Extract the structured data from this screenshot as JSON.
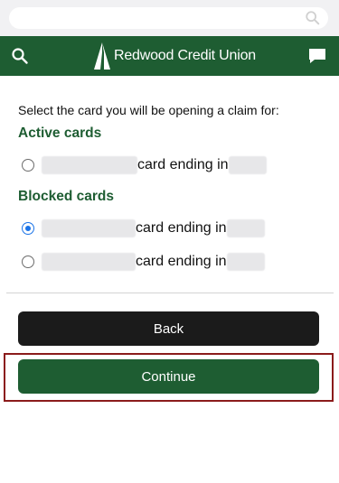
{
  "header": {
    "brand": "Redwood Credit Union",
    "icons": {
      "search": "search-icon",
      "chat": "chat-icon",
      "logo": "redwood-logo-icon"
    }
  },
  "browser": {
    "search_icon": "search-icon"
  },
  "main": {
    "prompt": "Select the card you will be opening a claim for:",
    "active_title": "Active cards",
    "blocked_title": "Blocked cards",
    "cards": [
      {
        "label": "card ending in",
        "selected": false,
        "group": "active"
      },
      {
        "label": "card ending in",
        "selected": true,
        "group": "blocked"
      },
      {
        "label": "card ending in",
        "selected": false,
        "group": "blocked"
      }
    ],
    "back_label": "Back",
    "continue_label": "Continue"
  },
  "colors": {
    "brand": "#1e5d32",
    "back": "#1b1b1b",
    "radio_selected": "#1a73e8",
    "highlight": "#8b1b1b"
  }
}
